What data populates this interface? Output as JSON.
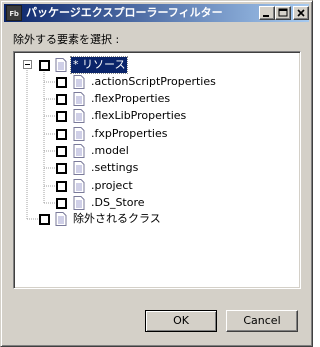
{
  "window": {
    "title": "パッケージエクスプローラーフィルター",
    "app_icon_text": "Fb"
  },
  "dialog": {
    "instruction_label": "除外する要素を選択 :"
  },
  "tree": {
    "root": {
      "label": "* リソース",
      "checked": false,
      "expanded": true,
      "selected": true
    },
    "children": [
      {
        "label": ".actionScriptProperties",
        "checked": false
      },
      {
        "label": ".flexProperties",
        "checked": false
      },
      {
        "label": ".flexLibProperties",
        "checked": false
      },
      {
        "label": ".fxpProperties",
        "checked": false
      },
      {
        "label": ".model",
        "checked": false
      },
      {
        "label": ".settings",
        "checked": false
      },
      {
        "label": ".project",
        "checked": false
      },
      {
        "label": ".DS_Store",
        "checked": false
      }
    ],
    "sibling": {
      "label": "除外されるクラス",
      "checked": false
    }
  },
  "buttons": {
    "ok_label": "OK",
    "cancel_label": "Cancel"
  },
  "colors": {
    "title_gradient_start": "#0a246a",
    "title_gradient_end": "#a6caf0",
    "dialog_face": "#d4d0c8",
    "selection": "#0a246a"
  }
}
